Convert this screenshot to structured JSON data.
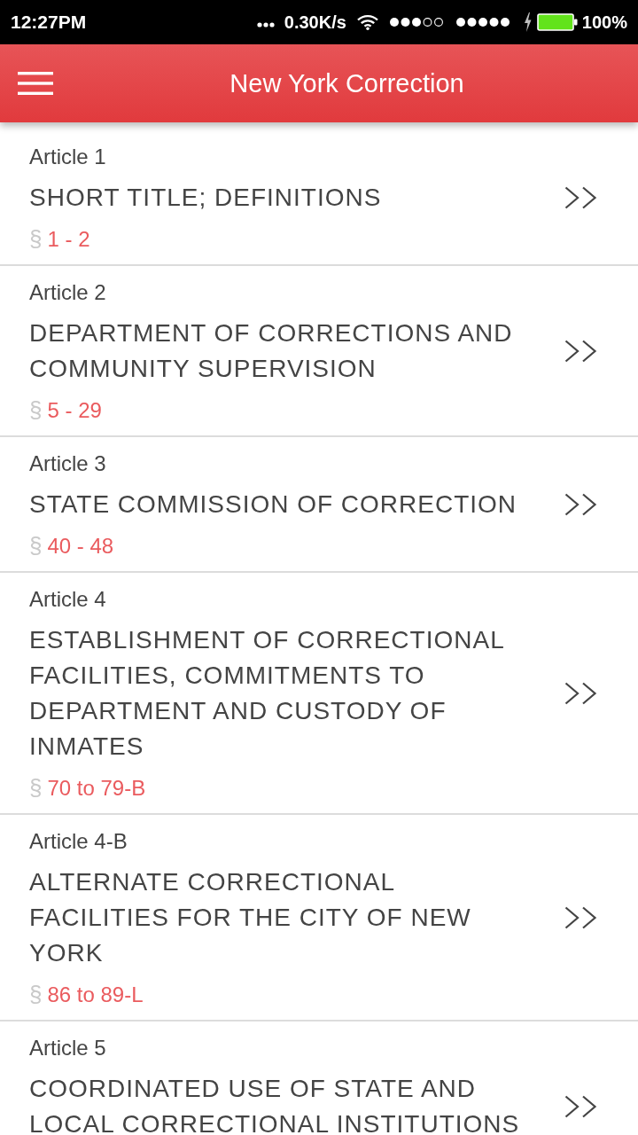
{
  "status_bar": {
    "time": "12:27PM",
    "network_speed": "0.30K/s",
    "battery_percent": "100%"
  },
  "app_bar": {
    "title": "New York Correction"
  },
  "articles": [
    {
      "label": "Article 1",
      "title": "SHORT TITLE; DEFINITIONS",
      "section_sign": "§",
      "sections": "1 - 2"
    },
    {
      "label": "Article 2",
      "title": "DEPARTMENT OF CORRECTIONS AND COMMUNITY SUPERVISION",
      "section_sign": "§",
      "sections": "5 - 29"
    },
    {
      "label": "Article 3",
      "title": "STATE COMMISSION OF CORRECTION",
      "section_sign": "§",
      "sections": "40 - 48"
    },
    {
      "label": "Article 4",
      "title": "ESTABLISHMENT OF CORRECTIONAL FACILITIES, COMMITMENTS TO DEPARTMENT AND CUSTODY OF INMATES",
      "section_sign": "§",
      "sections": "70 to 79-B"
    },
    {
      "label": "Article 4-B",
      "title": "ALTERNATE CORRECTIONAL FACILITIES FOR THE CITY OF NEW YORK",
      "section_sign": "§",
      "sections": "86 to 89-L"
    },
    {
      "label": "Article 5",
      "title": "COORDINATED USE OF STATE AND LOCAL CORRECTIONAL INSTITUTIONS"
    }
  ]
}
